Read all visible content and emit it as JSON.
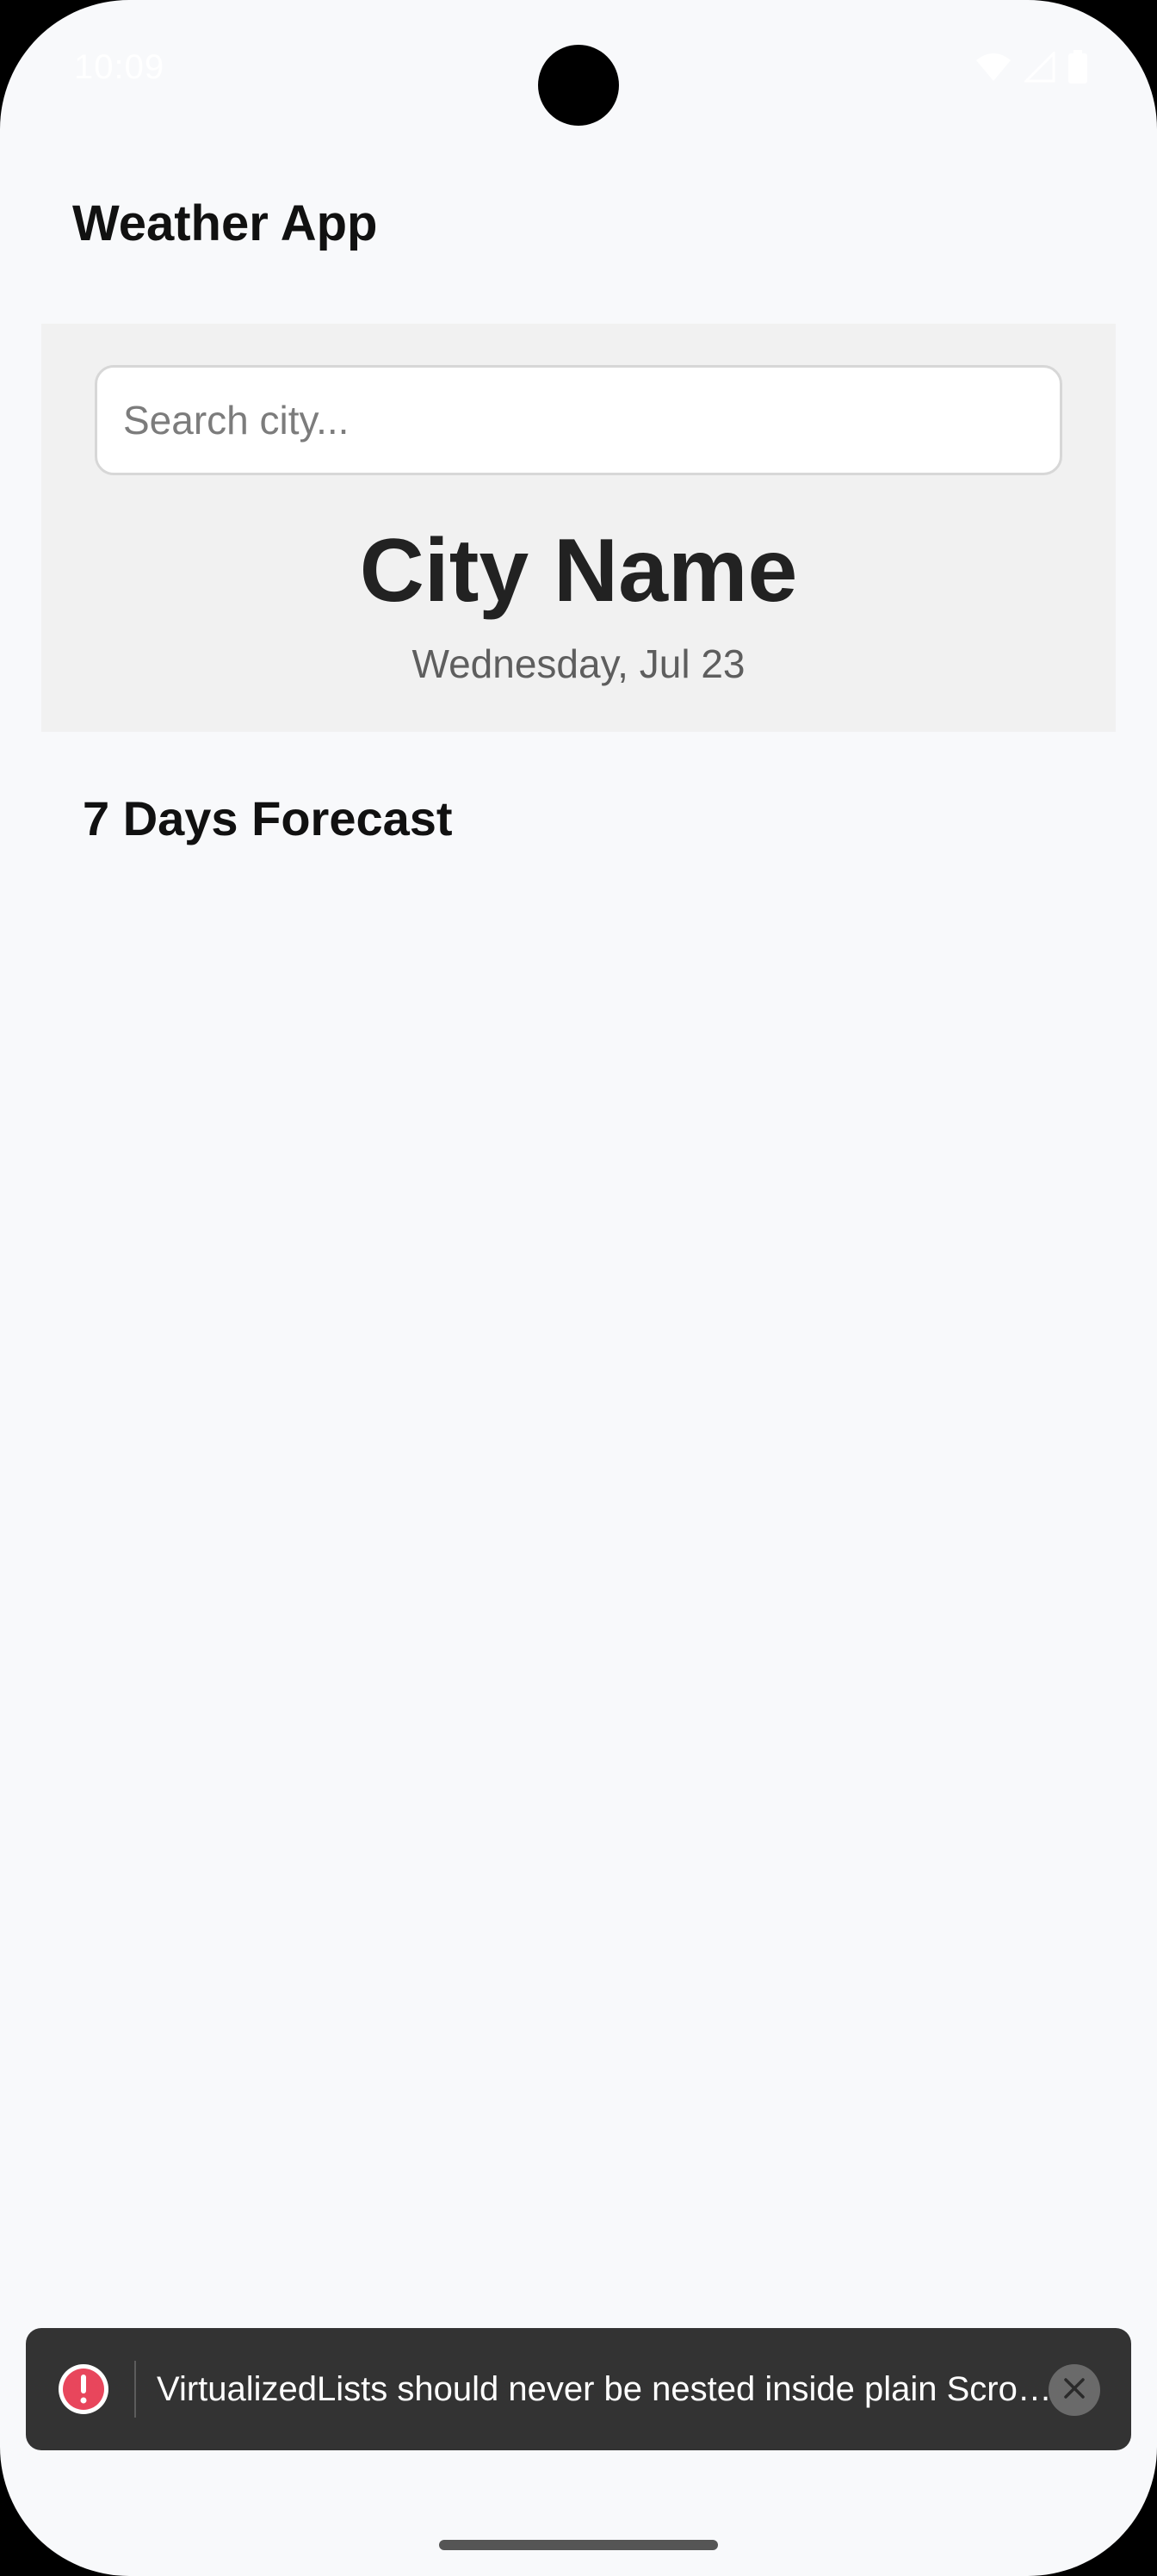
{
  "status_bar": {
    "time": "10:09",
    "icons": [
      "wifi-icon",
      "signal-icon",
      "battery-icon"
    ]
  },
  "app": {
    "title": "Weather App"
  },
  "header": {
    "search_placeholder": "Search city...",
    "search_value": "",
    "city_name": "City Name",
    "date": "Wednesday, Jul 23"
  },
  "forecast": {
    "title": "7 Days Forecast",
    "days": []
  },
  "toast": {
    "icon": "error-icon",
    "message": "VirtualizedLists should never be nested inside plain ScrollViews with the same orientation",
    "close_icon": "close-icon",
    "colors": {
      "background": "#333333",
      "error": "#e8465c"
    }
  },
  "colors": {
    "background": "#f8f9fb",
    "header_card": "#f1f1f1",
    "text_primary": "#111111",
    "text_secondary": "#5e5e5e"
  }
}
